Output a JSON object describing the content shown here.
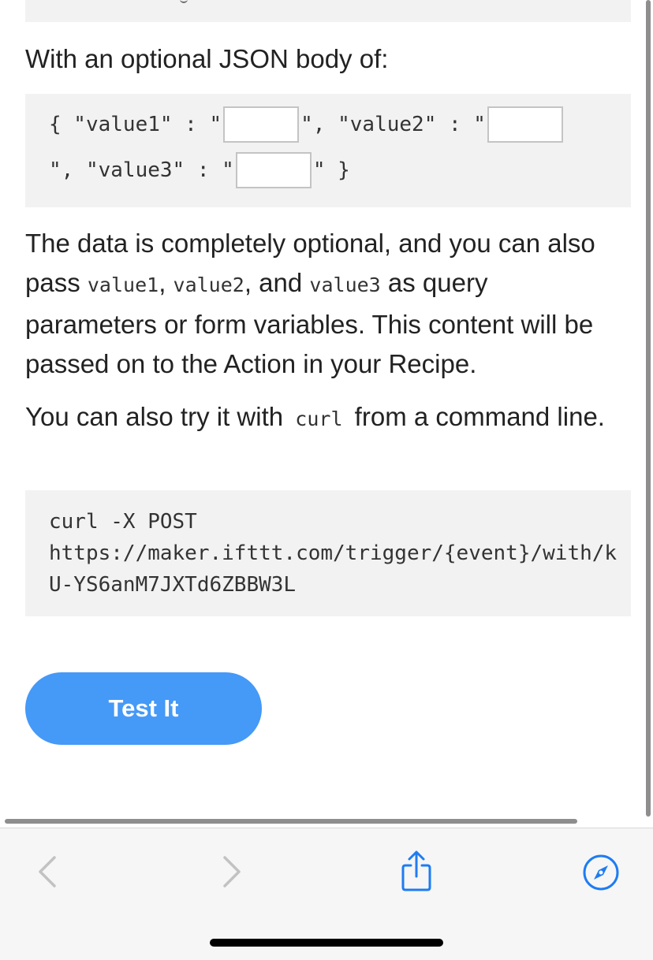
{
  "intro": {
    "json_body_label": "With an optional JSON body of:"
  },
  "json_body": {
    "open": "{ \"value1\" : \"",
    "mid1": "\", \"value2\" : \"",
    "line2_start": "\", \"value3\" : \"",
    "close": "\" }",
    "value1": "",
    "value2": "",
    "value3": ""
  },
  "description": {
    "part1": "The data is completely optional, and you can also pass ",
    "code1": "value1",
    "sep1": ", ",
    "code2": "value2",
    "sep2": ", and ",
    "code3": "value3",
    "part2": " as query parameters or form variables. This content will be passed on to the Action in your Recipe."
  },
  "curl_note": {
    "part1": "You can also try it with ",
    "code": "curl",
    "part2": " from a command line."
  },
  "curl_command": {
    "line1": "curl -X POST",
    "line2": "https://maker.ifttt.com/trigger/{event}/with/k",
    "line3": "U-YS6anM7JXTd6ZBBW3L"
  },
  "test_button": {
    "label": "Test It"
  },
  "toolbar": {
    "back_icon": "chevron-left-icon",
    "forward_icon": "chevron-right-icon",
    "share_icon": "share-icon",
    "browser_icon": "compass-icon",
    "accent_color": "#1e7cf2"
  }
}
